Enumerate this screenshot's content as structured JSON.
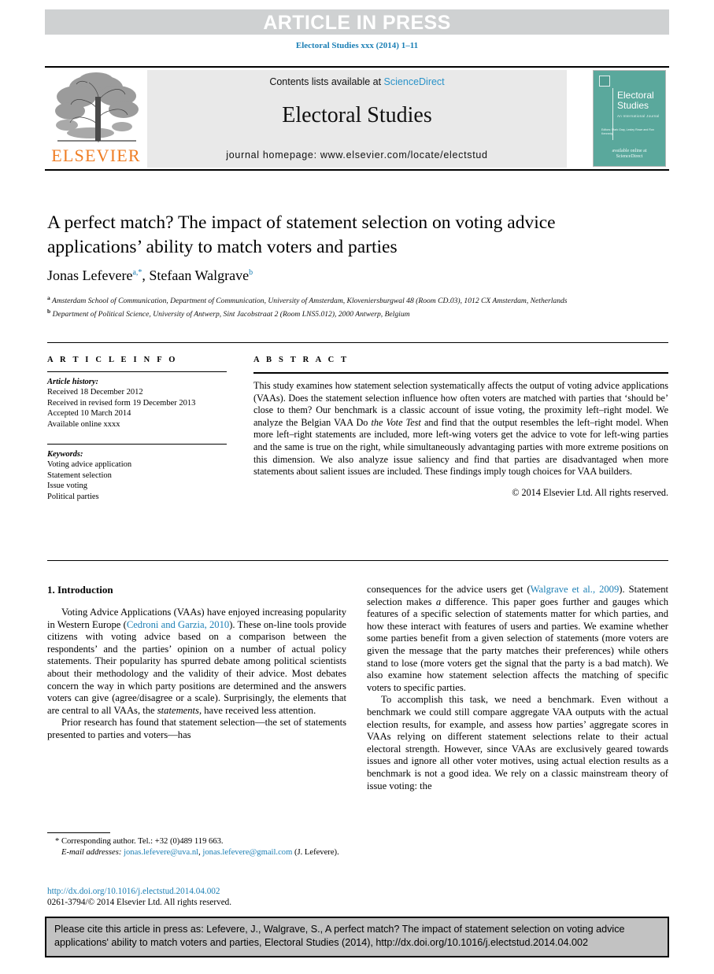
{
  "banner": {
    "label": "ARTICLE IN PRESS",
    "background": "#cfd1d2",
    "text_color": "#ffffff"
  },
  "journal_ref": "Electoral Studies xxx (2014) 1–11",
  "masthead": {
    "contents_prefix": "Contents lists available at ",
    "sciencedirect": "ScienceDirect",
    "journal_title": "Electoral Studies",
    "homepage": "journal homepage: www.elsevier.com/locate/electstud",
    "publisher_name": "ELSEVIER",
    "publisher_color": "#ef7c22",
    "cover": {
      "title_line1": "Electoral",
      "title_line2": "Studies",
      "subtitle": "An International Journal",
      "editors": "Editors: Mark Gray, Lesley Rowe and Ron Kennedy",
      "logo_top": "available online at",
      "logo_text": "ScienceDirect",
      "background": "#5aa89c"
    }
  },
  "article": {
    "title": "A perfect match? The impact of statement selection on voting advice applications’ ability to match voters and parties",
    "authors": [
      {
        "name": "Jonas Lefevere",
        "marks": "a,*"
      },
      {
        "name": "Stefaan Walgrave",
        "marks": "b"
      }
    ],
    "affiliations": [
      {
        "mark": "a",
        "text": "Amsterdam School of Communication, Department of Communication, University of Amsterdam, Kloveniersburgwal 48 (Room CD.03), 1012 CX Amsterdam, Netherlands"
      },
      {
        "mark": "b",
        "text": "Department of Political Science, University of Antwerp, Sint Jacobstraat 2 (Room LNS5.012), 2000 Antwerp, Belgium"
      }
    ]
  },
  "article_info": {
    "heading": "A R T I C L E  I N F O",
    "history_label": "Article history:",
    "history": [
      "Received 18 December 2012",
      "Received in revised form 19 December 2013",
      "Accepted 10 March 2014",
      "Available online xxxx"
    ],
    "keywords_label": "Keywords:",
    "keywords": [
      "Voting advice application",
      "Statement selection",
      "Issue voting",
      "Political parties"
    ]
  },
  "abstract": {
    "heading": "A B S T R A C T",
    "part1": "This study examines how statement selection systematically affects the output of voting advice applications (VAAs). Does the statement selection influence how often voters are matched with parties that ‘should be’ close to them? Our benchmark is a classic account of issue voting, the proximity left–right model. We analyze the Belgian VAA Do ",
    "italic1": "the Vote Test",
    "part2": " and find that the output resembles the left–right model. When more left–right statements are included, more left-wing voters get the advice to vote for left-wing parties and the same is true on the right, while simultaneously advantaging parties with more extreme positions on this dimension. We also analyze issue saliency and find that parties are disadvantaged when more statements about salient issues are included. These findings imply tough choices for VAA builders.",
    "copyright": "© 2014 Elsevier Ltd. All rights reserved."
  },
  "body": {
    "section_number_title": "1. Introduction",
    "left": [
      {
        "indent": true,
        "runs": [
          {
            "t": "Voting Advice Applications (VAAs) have enjoyed increasing popularity in Western Europe (",
            "k": "plain"
          },
          {
            "t": "Cedroni and Garzia, 2010",
            "k": "cite"
          },
          {
            "t": "). These on-line tools provide citizens with voting advice based on a comparison between the respondents’ and the parties’ opinion on a number of actual policy statements. Their popularity has spurred debate among political scientists about their methodology and the validity of their advice. Most debates concern the way in which party positions are determined and the answers voters can give (agree/disagree or a scale). Surprisingly, the elements that are central to all VAAs, the ",
            "k": "plain"
          },
          {
            "t": "statements",
            "k": "italic"
          },
          {
            "t": ", have received less attention.",
            "k": "plain"
          }
        ]
      },
      {
        "indent": true,
        "runs": [
          {
            "t": "Prior research has found that statement selection—the set of statements presented to parties and voters—has",
            "k": "plain"
          }
        ]
      }
    ],
    "right": [
      {
        "indent": false,
        "runs": [
          {
            "t": "consequences for the advice users get (",
            "k": "plain"
          },
          {
            "t": "Walgrave et al., 2009",
            "k": "cite"
          },
          {
            "t": "). Statement selection makes ",
            "k": "plain"
          },
          {
            "t": "a",
            "k": "italic"
          },
          {
            "t": " difference. This paper goes further and gauges which features of a specific selection of statements matter for which parties, and how these interact with features of users and parties. We examine whether some parties benefit from a given selection of statements (more voters are given the message that the party matches their preferences) while others stand to lose (more voters get the signal that the party is a bad match). We also examine how statement selection affects the matching of specific voters to specific parties.",
            "k": "plain"
          }
        ]
      },
      {
        "indent": true,
        "runs": [
          {
            "t": "To accomplish this task, we need a benchmark. Even without a benchmark we could still compare aggregate VAA outputs with the actual election results, for example, and assess how parties’ aggregate scores in VAAs relying on different statement selections relate to their actual electoral strength. However, since VAAs are exclusively geared towards issues and ignore all other voter motives, using actual election results as a benchmark is not a good idea. We rely on a classic mainstream theory of issue voting: the",
            "k": "plain"
          }
        ]
      }
    ]
  },
  "footnote": {
    "corresponding": "* Corresponding author. Tel.: +32 (0)489 119 663.",
    "email_label": "E-mail addresses:",
    "email1": "jonas.lefevere@uva.nl",
    "email_sep": ", ",
    "email2": "jonas.lefevere@gmail.com",
    "email_tail": " (J. Lefevere)."
  },
  "doi": {
    "url": "http://dx.doi.org/10.1016/j.electstud.2014.04.002",
    "issn_line": "0261-3794/© 2014 Elsevier Ltd. All rights reserved."
  },
  "cite_box": {
    "text": "Please cite this article in press as: Lefevere, J., Walgrave, S., A perfect match? The impact of statement selection on voting advice applications' ability to match voters and parties, Electoral Studies (2014), http://dx.doi.org/10.1016/j.electstud.2014.04.002",
    "background": "#c2c2c2"
  }
}
